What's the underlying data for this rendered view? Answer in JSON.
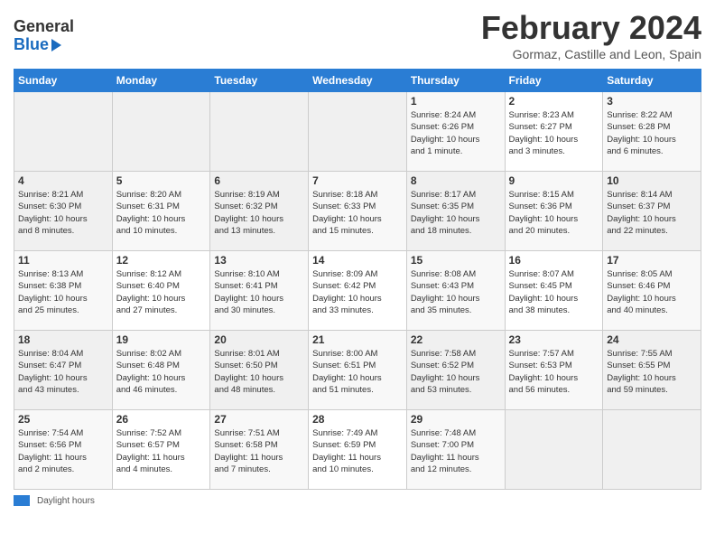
{
  "header": {
    "logo_line1": "General",
    "logo_line2": "Blue",
    "month_title": "February 2024",
    "location": "Gormaz, Castille and Leon, Spain"
  },
  "days_of_week": [
    "Sunday",
    "Monday",
    "Tuesday",
    "Wednesday",
    "Thursday",
    "Friday",
    "Saturday"
  ],
  "weeks": [
    [
      {
        "day": "",
        "info": ""
      },
      {
        "day": "",
        "info": ""
      },
      {
        "day": "",
        "info": ""
      },
      {
        "day": "",
        "info": ""
      },
      {
        "day": "1",
        "info": "Sunrise: 8:24 AM\nSunset: 6:26 PM\nDaylight: 10 hours\nand 1 minute."
      },
      {
        "day": "2",
        "info": "Sunrise: 8:23 AM\nSunset: 6:27 PM\nDaylight: 10 hours\nand 3 minutes."
      },
      {
        "day": "3",
        "info": "Sunrise: 8:22 AM\nSunset: 6:28 PM\nDaylight: 10 hours\nand 6 minutes."
      }
    ],
    [
      {
        "day": "4",
        "info": "Sunrise: 8:21 AM\nSunset: 6:30 PM\nDaylight: 10 hours\nand 8 minutes."
      },
      {
        "day": "5",
        "info": "Sunrise: 8:20 AM\nSunset: 6:31 PM\nDaylight: 10 hours\nand 10 minutes."
      },
      {
        "day": "6",
        "info": "Sunrise: 8:19 AM\nSunset: 6:32 PM\nDaylight: 10 hours\nand 13 minutes."
      },
      {
        "day": "7",
        "info": "Sunrise: 8:18 AM\nSunset: 6:33 PM\nDaylight: 10 hours\nand 15 minutes."
      },
      {
        "day": "8",
        "info": "Sunrise: 8:17 AM\nSunset: 6:35 PM\nDaylight: 10 hours\nand 18 minutes."
      },
      {
        "day": "9",
        "info": "Sunrise: 8:15 AM\nSunset: 6:36 PM\nDaylight: 10 hours\nand 20 minutes."
      },
      {
        "day": "10",
        "info": "Sunrise: 8:14 AM\nSunset: 6:37 PM\nDaylight: 10 hours\nand 22 minutes."
      }
    ],
    [
      {
        "day": "11",
        "info": "Sunrise: 8:13 AM\nSunset: 6:38 PM\nDaylight: 10 hours\nand 25 minutes."
      },
      {
        "day": "12",
        "info": "Sunrise: 8:12 AM\nSunset: 6:40 PM\nDaylight: 10 hours\nand 27 minutes."
      },
      {
        "day": "13",
        "info": "Sunrise: 8:10 AM\nSunset: 6:41 PM\nDaylight: 10 hours\nand 30 minutes."
      },
      {
        "day": "14",
        "info": "Sunrise: 8:09 AM\nSunset: 6:42 PM\nDaylight: 10 hours\nand 33 minutes."
      },
      {
        "day": "15",
        "info": "Sunrise: 8:08 AM\nSunset: 6:43 PM\nDaylight: 10 hours\nand 35 minutes."
      },
      {
        "day": "16",
        "info": "Sunrise: 8:07 AM\nSunset: 6:45 PM\nDaylight: 10 hours\nand 38 minutes."
      },
      {
        "day": "17",
        "info": "Sunrise: 8:05 AM\nSunset: 6:46 PM\nDaylight: 10 hours\nand 40 minutes."
      }
    ],
    [
      {
        "day": "18",
        "info": "Sunrise: 8:04 AM\nSunset: 6:47 PM\nDaylight: 10 hours\nand 43 minutes."
      },
      {
        "day": "19",
        "info": "Sunrise: 8:02 AM\nSunset: 6:48 PM\nDaylight: 10 hours\nand 46 minutes."
      },
      {
        "day": "20",
        "info": "Sunrise: 8:01 AM\nSunset: 6:50 PM\nDaylight: 10 hours\nand 48 minutes."
      },
      {
        "day": "21",
        "info": "Sunrise: 8:00 AM\nSunset: 6:51 PM\nDaylight: 10 hours\nand 51 minutes."
      },
      {
        "day": "22",
        "info": "Sunrise: 7:58 AM\nSunset: 6:52 PM\nDaylight: 10 hours\nand 53 minutes."
      },
      {
        "day": "23",
        "info": "Sunrise: 7:57 AM\nSunset: 6:53 PM\nDaylight: 10 hours\nand 56 minutes."
      },
      {
        "day": "24",
        "info": "Sunrise: 7:55 AM\nSunset: 6:55 PM\nDaylight: 10 hours\nand 59 minutes."
      }
    ],
    [
      {
        "day": "25",
        "info": "Sunrise: 7:54 AM\nSunset: 6:56 PM\nDaylight: 11 hours\nand 2 minutes."
      },
      {
        "day": "26",
        "info": "Sunrise: 7:52 AM\nSunset: 6:57 PM\nDaylight: 11 hours\nand 4 minutes."
      },
      {
        "day": "27",
        "info": "Sunrise: 7:51 AM\nSunset: 6:58 PM\nDaylight: 11 hours\nand 7 minutes."
      },
      {
        "day": "28",
        "info": "Sunrise: 7:49 AM\nSunset: 6:59 PM\nDaylight: 11 hours\nand 10 minutes."
      },
      {
        "day": "29",
        "info": "Sunrise: 7:48 AM\nSunset: 7:00 PM\nDaylight: 11 hours\nand 12 minutes."
      },
      {
        "day": "",
        "info": ""
      },
      {
        "day": "",
        "info": ""
      }
    ]
  ],
  "footer": {
    "legend_label": "Daylight hours"
  }
}
